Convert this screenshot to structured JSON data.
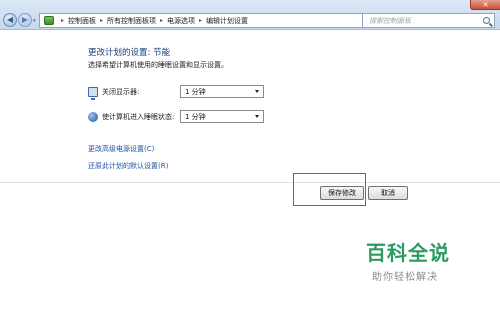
{
  "window": {
    "close_glyph": "✕"
  },
  "nav": {
    "back_glyph": "◀",
    "forward_glyph": "▶",
    "history_glyph": "▾"
  },
  "address": {
    "crumbs": [
      "控制面板",
      "所有控制面板项",
      "电源选项",
      "编辑计划设置"
    ],
    "separator": "▸",
    "drop_glyph": "▾",
    "refresh_glyph": "↻"
  },
  "search": {
    "placeholder": "搜索控制面板"
  },
  "main": {
    "title": "更改计划的设置: 节能",
    "subtitle": "选择希望计算机使用的睡眠设置和显示设置。",
    "display_label": "关闭显示器:",
    "display_value": "1 分钟",
    "sleep_label": "使计算机进入睡眠状态:",
    "sleep_value": "1 分钟",
    "advanced_link": "更改高级电源设置(C)",
    "restore_link": "还原此计划的默认设置(R)",
    "save_label": "保存修改",
    "cancel_label": "取消"
  },
  "watermark": {
    "logo_text": "百科全说",
    "sub_text": "助你轻松解决"
  },
  "colors": {
    "link": "#1f4f9a",
    "highlight": "#e0383b",
    "watermark": "#2c9b63"
  }
}
